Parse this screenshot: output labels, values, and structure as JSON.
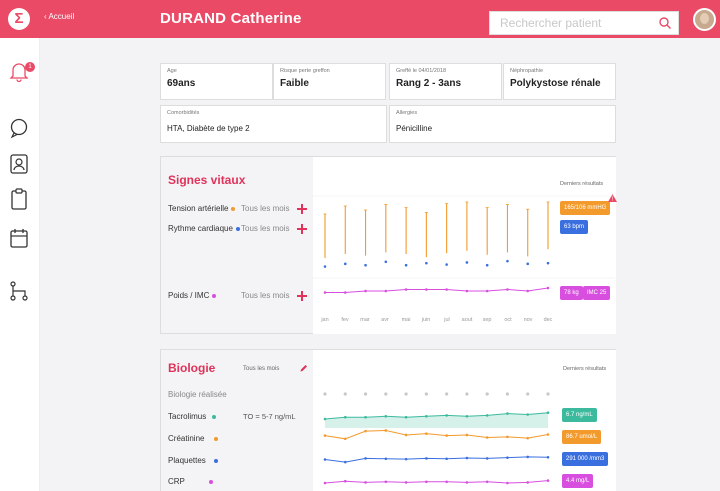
{
  "header": {
    "back_label": "‹ Accueil",
    "patient_name": "DURAND Catherine",
    "search_placeholder": "Rechercher patient"
  },
  "sidebar": {
    "items": [
      {
        "icon": "bell-icon"
      },
      {
        "icon": "chat-bubble-icon"
      },
      {
        "icon": "patient-profile-icon"
      },
      {
        "icon": "clipboard-icon"
      },
      {
        "icon": "calendar-icon"
      },
      {
        "icon": "workflow-icon"
      }
    ],
    "notification_badge": "1"
  },
  "info": {
    "age": {
      "label": "Age",
      "value": "69ans"
    },
    "risk": {
      "label": "Risque perte greffon",
      "value": "Faible"
    },
    "graft": {
      "label": "Greffé le 04/01/2018",
      "value": "Rang 2 - 3ans"
    },
    "nephro": {
      "label": "Néphropathie",
      "value": "Polykystose rénale"
    },
    "comorb": {
      "label": "Comorbidités",
      "value": "HTA, Diabète de type 2"
    },
    "allergies": {
      "label": "Allergies",
      "value": "Pénicilline"
    }
  },
  "vitals": {
    "title": "Signes vitaux",
    "latest_label": "Derniers résultats",
    "rows": [
      {
        "label": "Tension artérielle",
        "freq": "Tous les mois",
        "color": "#f39a2c"
      },
      {
        "label": "Rythme cardiaque",
        "freq": "Tous les mois",
        "color": "#3a6fe0"
      },
      {
        "label": "Poids / IMC",
        "freq": "Tous les mois",
        "color": "#d84fe0"
      }
    ],
    "badges": {
      "bp": "165/106 mmHG",
      "hr": "63 bpm",
      "weight": "78 kg",
      "bmi": "IMC 25"
    },
    "alert_icon": "warning-triangle-icon"
  },
  "biology": {
    "title": "Biologie",
    "freq": "Tous les mois",
    "latest_label": "Derniers résultats",
    "done_label": "Biologie réalisée",
    "rows": [
      {
        "label": "Tacrolimus",
        "target": "TO = 5-7 ng/mL",
        "color": "#3cba9e"
      },
      {
        "label": "Créatinine",
        "target": "",
        "color": "#f39a2c"
      },
      {
        "label": "Plaquettes",
        "target": "",
        "color": "#3a6fe0"
      },
      {
        "label": "CRP",
        "target": "",
        "color": "#d84fe0"
      }
    ],
    "badges": {
      "tacro": "6.7 ng/mL",
      "creat": "86.7 umol/L",
      "plaq": "291 000 /mm3",
      "crp": "4.4 mg/L"
    }
  },
  "months": [
    "jan",
    "fev",
    "mar",
    "avr",
    "mai",
    "juin",
    "jul",
    "aout",
    "sep",
    "oct",
    "nov",
    "dec"
  ],
  "chart_data": {
    "type": "line",
    "categories": [
      "jan",
      "fev",
      "mar",
      "avr",
      "mai",
      "juin",
      "jul",
      "aout",
      "sep",
      "oct",
      "nov",
      "dec"
    ],
    "series": [
      {
        "name": "Tension artérielle",
        "color": "#f39a2c",
        "values": [
          [
            150,
            95
          ],
          [
            160,
            100
          ],
          [
            155,
            98
          ],
          [
            162,
            102
          ],
          [
            158,
            100
          ],
          [
            152,
            96
          ],
          [
            163,
            101
          ],
          [
            165,
            104
          ],
          [
            158,
            99
          ],
          [
            162,
            102
          ],
          [
            156,
            97
          ],
          [
            165,
            106
          ]
        ]
      },
      {
        "name": "Rythme cardiaque",
        "color": "#3a6fe0",
        "values": [
          58,
          62,
          60,
          65,
          60,
          63,
          61,
          64,
          60,
          66,
          62,
          63
        ]
      },
      {
        "name": "Poids / IMC",
        "color": "#d84fe0",
        "values": [
          75,
          75,
          76,
          76,
          77,
          77,
          77,
          76,
          76,
          77,
          76,
          78
        ]
      },
      {
        "name": "Tacrolimus",
        "color": "#3cba9e",
        "values": [
          6.0,
          6.2,
          6.2,
          6.3,
          6.2,
          6.3,
          6.4,
          6.3,
          6.4,
          6.6,
          6.5,
          6.7
        ]
      },
      {
        "name": "Créatinine",
        "color": "#f39a2c",
        "values": [
          85,
          80,
          92,
          93,
          86,
          88,
          85,
          86,
          82,
          83,
          81,
          86.7
        ]
      },
      {
        "name": "Plaquettes",
        "color": "#3a6fe0",
        "values": [
          285000,
          278000,
          288000,
          287000,
          286000,
          288000,
          287000,
          289000,
          288000,
          290000,
          292000,
          291000
        ]
      },
      {
        "name": "CRP",
        "color": "#d84fe0",
        "values": [
          4.0,
          4.3,
          4.1,
          4.2,
          4.1,
          4.2,
          4.2,
          4.1,
          4.2,
          4.0,
          4.1,
          4.4
        ]
      }
    ]
  }
}
